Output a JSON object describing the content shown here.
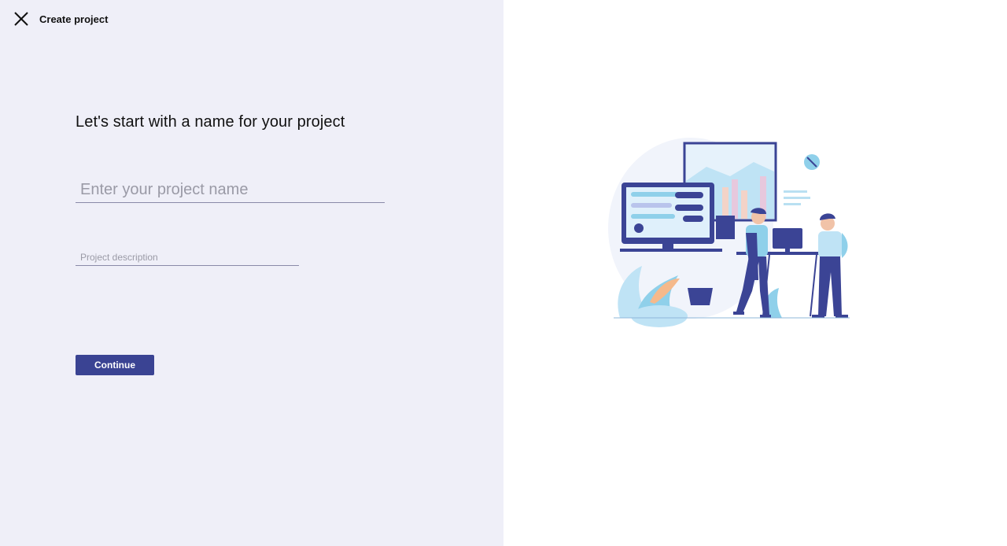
{
  "header": {
    "close_icon": "close-icon",
    "title": "Create project"
  },
  "form": {
    "heading": "Let's start with a name for your project",
    "name_placeholder": "Enter your project name",
    "name_value": "",
    "description_placeholder": "Project description",
    "description_value": "",
    "continue_label": "Continue"
  },
  "illustration": {
    "subject": "two people working at desks with computer monitors",
    "icon": "team-workspace-illustration"
  },
  "colors": {
    "left_panel_bg": "#efeff8",
    "right_panel_bg": "#ffffff",
    "accent": "#3a4393",
    "input_underline": "#8a8aa8",
    "illustration_primary": "#3b4495",
    "illustration_secondary": "#8fd0ea"
  }
}
